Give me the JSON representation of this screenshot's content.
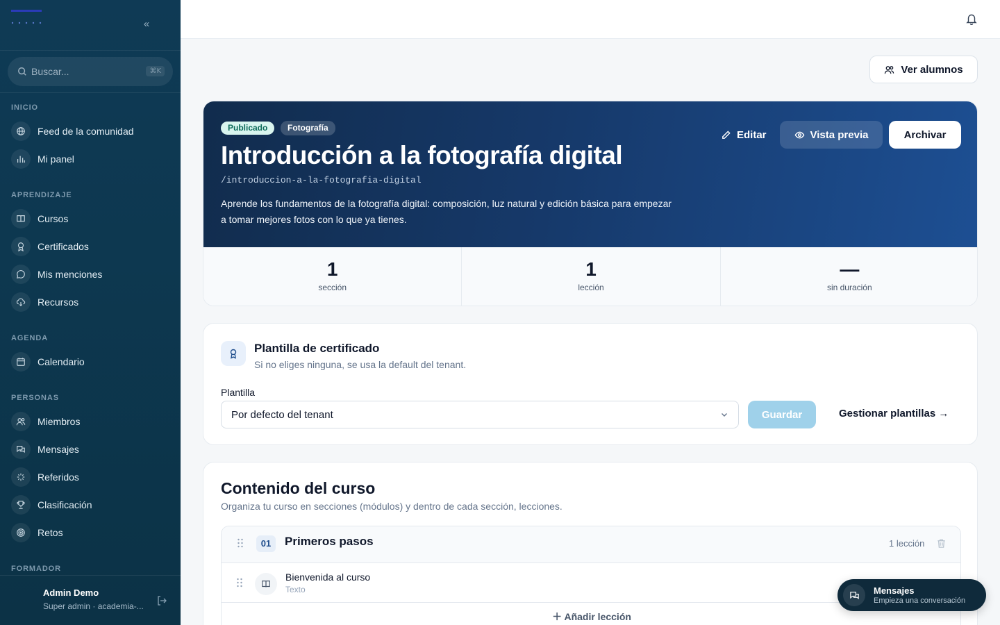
{
  "sidebar": {
    "search": {
      "placeholder": "Buscar...",
      "shortcut": "⌘K"
    },
    "sections": {
      "inicio": "INICIO",
      "aprendizaje": "APRENDIZAJE",
      "agenda": "AGENDA",
      "personas": "PERSONAS",
      "formador": "FORMADOR"
    },
    "items": {
      "feed": "Feed de la comunidad",
      "panel": "Mi panel",
      "cursos": "Cursos",
      "certificados": "Certificados",
      "menciones": "Mis menciones",
      "recursos": "Recursos",
      "calendario": "Calendario",
      "miembros": "Miembros",
      "mensajes": "Mensajes",
      "referidos": "Referidos",
      "clasificacion": "Clasificación",
      "retos": "Retos"
    },
    "user": {
      "name": "Admin Demo",
      "role": "Super admin · academia-..."
    }
  },
  "header": {
    "ver_alumnos": "Ver alumnos"
  },
  "course": {
    "status_badge": "Publicado",
    "category_badge": "Fotografía",
    "title": "Introducción a la fotografía digital",
    "slug": "/introduccion-a-la-fotografia-digital",
    "description": "Aprende los fundamentos de la fotografía digital: composición, luz natural y edición básica para empezar a tomar mejores fotos con lo que ya tienes.",
    "actions": {
      "edit": "Editar",
      "preview": "Vista previa",
      "archive": "Archivar"
    },
    "stats": [
      {
        "value": "1",
        "label": "sección"
      },
      {
        "value": "1",
        "label": "lección"
      },
      {
        "value": "—",
        "label": "sin duración"
      }
    ]
  },
  "certificate": {
    "title": "Plantilla de certificado",
    "subtitle": "Si no eliges ninguna, se usa la default del tenant.",
    "field_label": "Plantilla",
    "selected": "Por defecto del tenant",
    "save": "Guardar",
    "manage_link": "Gestionar plantillas →"
  },
  "content": {
    "title": "Contenido del curso",
    "subtitle": "Organiza tu curso en secciones (módulos) y dentro de cada sección, lecciones.",
    "sections": [
      {
        "number": "01",
        "title": "Primeros pasos",
        "count": "1 lección",
        "lessons": [
          {
            "title": "Bienvenida al curso",
            "type": "Texto"
          }
        ],
        "add_lesson": "Añadir lección"
      }
    ]
  },
  "chat": {
    "title": "Mensajes",
    "subtitle": "Empieza una conversación"
  },
  "colors": {
    "sidebar": "#0f3a55",
    "hero_start": "#112c4d",
    "hero_end": "#1d4f93",
    "accent_save": "#9fd1ea",
    "badge_green": "#d9f5ef"
  }
}
